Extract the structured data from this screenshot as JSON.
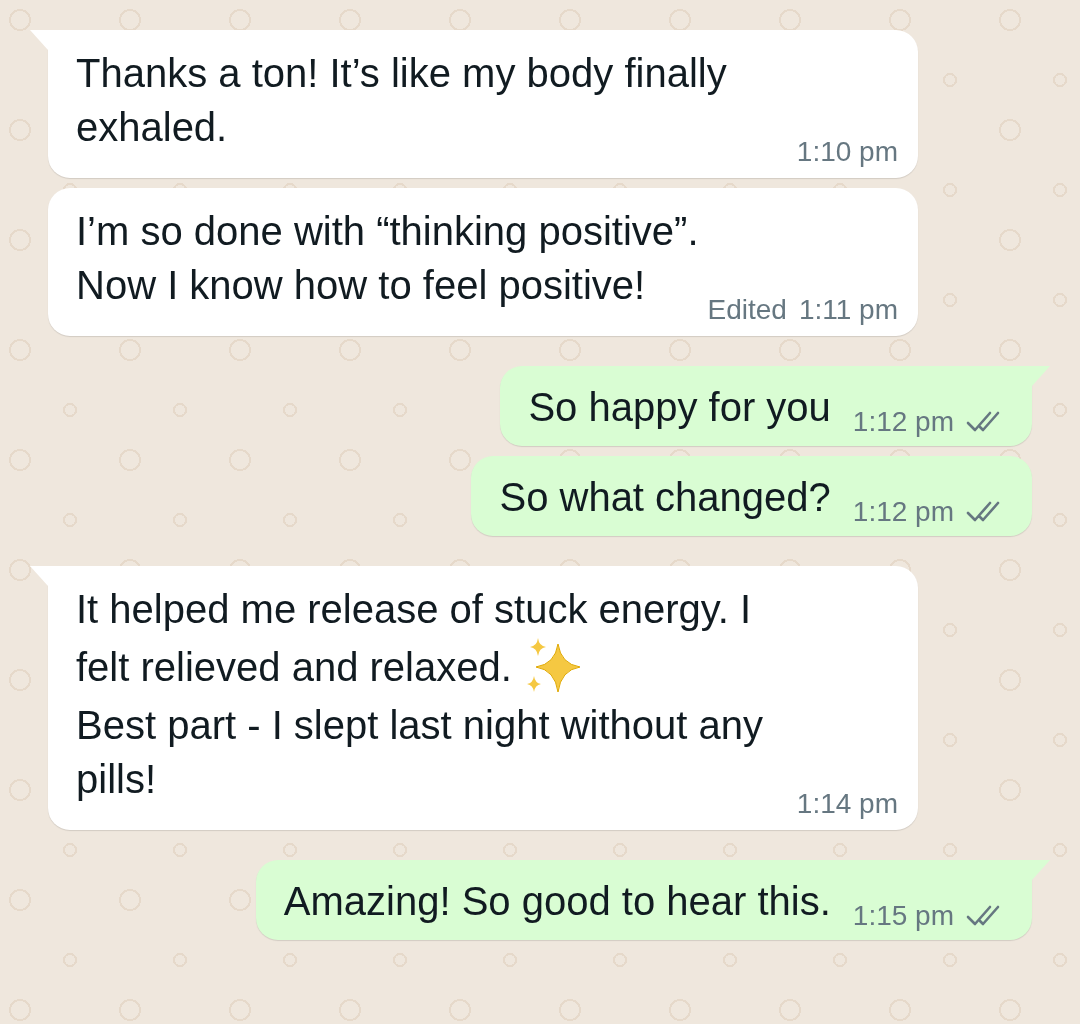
{
  "messages": [
    {
      "kind": "incoming",
      "tail": true,
      "lines": [
        {
          "kind": "text",
          "text": "Thanks a ton! It’s like my body finally"
        },
        {
          "kind": "text",
          "text": "exhaled."
        }
      ],
      "time": "1:10 pm"
    },
    {
      "kind": "incoming",
      "tail": false,
      "lines": [
        {
          "kind": "text",
          "text": "I’m so done with “thinking positive”."
        },
        {
          "kind": "text",
          "text": "Now I know how to feel positive!"
        }
      ],
      "edited": "Edited",
      "time": "1:11 pm"
    },
    {
      "kind": "outgoing",
      "tail": true,
      "lines": [
        {
          "kind": "text",
          "text": "So happy for you"
        }
      ],
      "time": "1:12 pm",
      "read": false
    },
    {
      "kind": "outgoing",
      "tail": false,
      "lines": [
        {
          "kind": "text",
          "text": "So what changed?"
        }
      ],
      "time": "1:12 pm",
      "read": false
    },
    {
      "kind": "incoming",
      "tail": true,
      "lines": [
        {
          "kind": "text",
          "text": "It helped me release of stuck energy. I"
        },
        {
          "kind": "sparkles",
          "text": "felt relieved and relaxed."
        },
        {
          "kind": "text",
          "text": "Best part - I slept last night without any"
        },
        {
          "kind": "text",
          "text": "pills!"
        }
      ],
      "time": "1:14 pm"
    },
    {
      "kind": "outgoing",
      "tail": true,
      "lines": [
        {
          "kind": "text",
          "text": "Amazing! So good to hear this."
        }
      ],
      "time": "1:15 pm",
      "read": false
    }
  ]
}
